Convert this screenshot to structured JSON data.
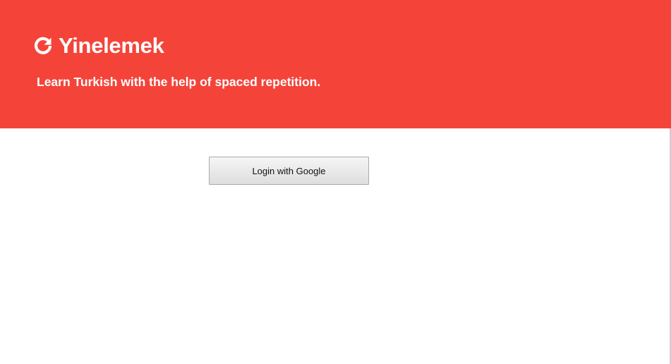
{
  "header": {
    "brand_icon": "refresh-icon",
    "brand_name": "Yinelemek",
    "tagline": "Learn Turkish with the help of spaced repetition.",
    "background_color": "#f4443a"
  },
  "main": {
    "login_button_label": "Login with Google"
  }
}
